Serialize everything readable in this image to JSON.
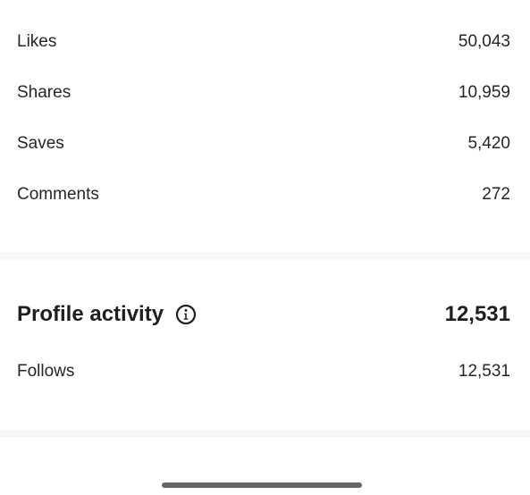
{
  "engagement": {
    "rows": [
      {
        "label": "Likes",
        "value": "50,043"
      },
      {
        "label": "Shares",
        "value": "10,959"
      },
      {
        "label": "Saves",
        "value": "5,420"
      },
      {
        "label": "Comments",
        "value": "272"
      }
    ]
  },
  "profile_activity": {
    "title": "Profile activity",
    "info_icon": "info-icon",
    "total": "12,531",
    "rows": [
      {
        "label": "Follows",
        "value": "12,531"
      }
    ]
  },
  "colors": {
    "text": "#262626",
    "heading": "#1f1f1f",
    "divider": "#f7f7f7",
    "home_indicator": "#666666"
  }
}
